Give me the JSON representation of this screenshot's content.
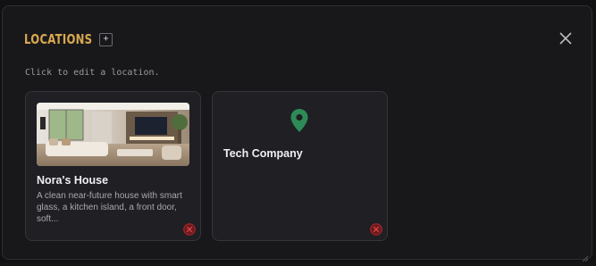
{
  "modal": {
    "title": "LOCATIONS",
    "add_label": "+",
    "hint": "Click to edit a location."
  },
  "colors": {
    "title": "#d9a84e",
    "pin": "#2e8b57",
    "delete": "#b3262b"
  },
  "icons": {
    "add": "plus-icon",
    "close": "close-icon",
    "pin": "map-pin-icon",
    "delete": "delete-circle-icon",
    "resize": "resize-grip-icon"
  },
  "locations": [
    {
      "name": "Nora's House",
      "description": "A clean near-future house with smart glass, a kitchen island, a front door, soft...",
      "thumbnail": "living-room-photo"
    },
    {
      "name": "Tech Company",
      "description": "",
      "thumbnail": "map-pin-icon"
    }
  ]
}
